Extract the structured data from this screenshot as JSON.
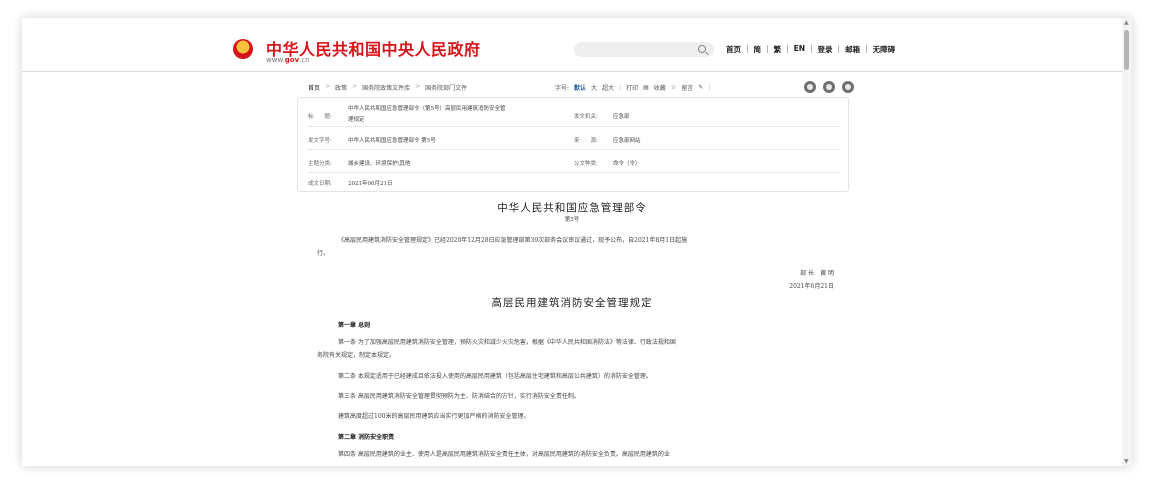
{
  "header": {
    "site_name": "中华人民共和国中央人民政府",
    "site_url_prefix": "www.",
    "site_url_brand": "gov",
    "site_url_suffix": ".cn",
    "nav": [
      "首页",
      "简",
      "繁",
      "EN",
      "登录",
      "邮箱",
      "无障碍"
    ]
  },
  "toolbar": {
    "breadcrumbs": [
      "首页",
      "政策",
      "国务院政策文件库",
      "国务院部门文件"
    ],
    "font_label": "字号:",
    "font_default": "默认",
    "font_large": "大",
    "font_xlarge": "超大",
    "print": "打印",
    "favorite": "收藏",
    "keep": "留言"
  },
  "info": {
    "title_label": "标　　题:",
    "title_value_1": "中华人民共和国应急管理部令（第5号）高层民用建筑消防安全管",
    "title_value_2": "理规定",
    "issuer_label": "发文机关:",
    "issuer_value": "应急部",
    "doc_no_label": "发文字号:",
    "doc_no_value": "中华人民共和国应急管理部令 第5号",
    "source_label": "来　　源:",
    "source_value": "应急部网站",
    "topic_label": "主题分类:",
    "topic_value": "城乡建设、环境保护\\其他",
    "type_label": "公文种类:",
    "type_value": "命令（令）",
    "date_label": "成文日期:",
    "date_value": "2021年06月21日"
  },
  "article": {
    "title": "中华人民共和国应急管理部令",
    "number": "第5号",
    "intro_1": "《高层民用建筑消防安全管理规定》已经2020年12月28日应急管理部第39次部务会议审议通过，现予公布，自2021年8月1日起施",
    "intro_2": "行。",
    "signer": "部 长　黄 明",
    "sign_date": "2021年6月21日",
    "rule_title": "高层民用建筑消防安全管理规定",
    "chapter1": "第一章 总则",
    "art1_1": "第一条 为了加强高层民用建筑消防安全管理，预防火灾和减少火灾危害，根据《中华人民共和国消防法》等法律、行政法规和国",
    "art1_2": "务院有关规定，制定本规定。",
    "art2": "第二条 本规定适用于已经建成且依法投入使用的高层民用建筑（包括高层住宅建筑和高层公共建筑）的消防安全管理。",
    "art3": "第三条 高层民用建筑消防安全管理贯彻预防为主、防消结合的方针，实行消防安全责任制。",
    "art3b": "建筑高度超过100米的高层民用建筑应当实行更加严格的消防安全管理。",
    "chapter2": "第二章 消防安全职责",
    "art4": "第四条 高层民用建筑的业主、使用人是高层民用建筑消防安全责任主体，对高层民用建筑的消防安全负责。高层民用建筑的业"
  }
}
